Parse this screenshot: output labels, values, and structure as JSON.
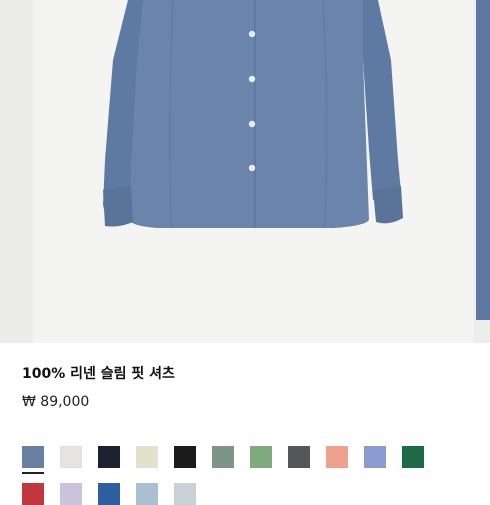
{
  "product": {
    "title": "100% 리넨 슬림 핏 셔츠",
    "price": "₩ 89,000"
  },
  "colors": {
    "shirt": "#6a84ab",
    "shirt_shadow": "#5a7399",
    "button": "#e9eef6"
  },
  "swatch_colors": [
    "#6a80a3",
    "#e8e3e3",
    "#1c2230",
    "#e2e2c8",
    "#1c1c1c",
    "#7c948a",
    "#7eaa7d",
    "#555657",
    "#eea28d",
    "#8c9bd0",
    "#1d6a45",
    "#c23640",
    "#c9c4dc",
    "#2e5f9e",
    "#a8c0cf",
    "#c8d0d8"
  ],
  "selected_swatch": 0
}
